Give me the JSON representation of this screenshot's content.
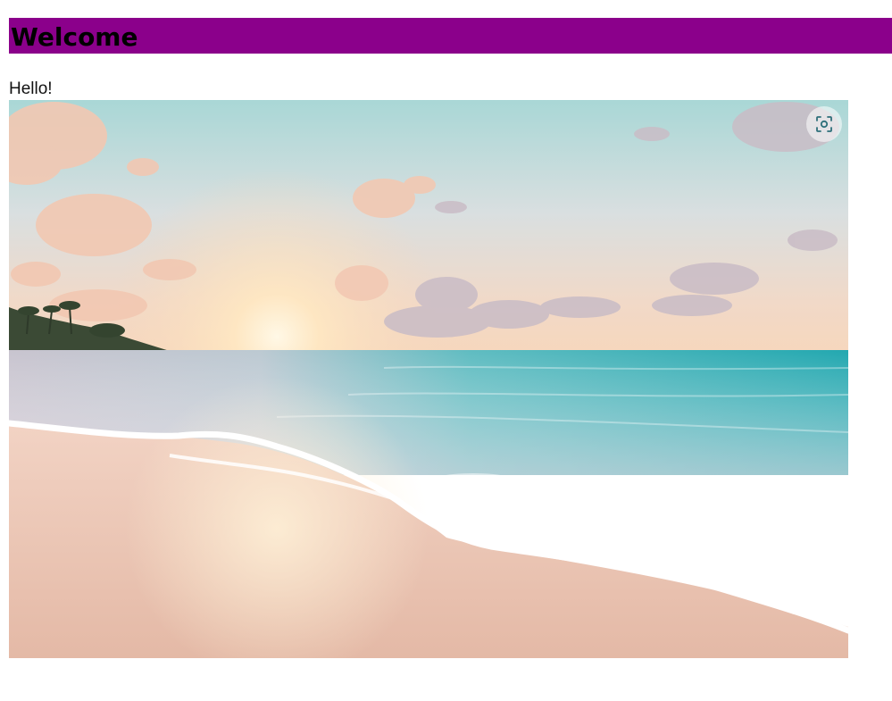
{
  "header": {
    "title": "Welcome",
    "background": "#8b008b"
  },
  "greeting": {
    "text": "Hello!"
  },
  "image": {
    "subject": "beach-sunset-photo",
    "overlay_icon": "visual-search-icon"
  }
}
